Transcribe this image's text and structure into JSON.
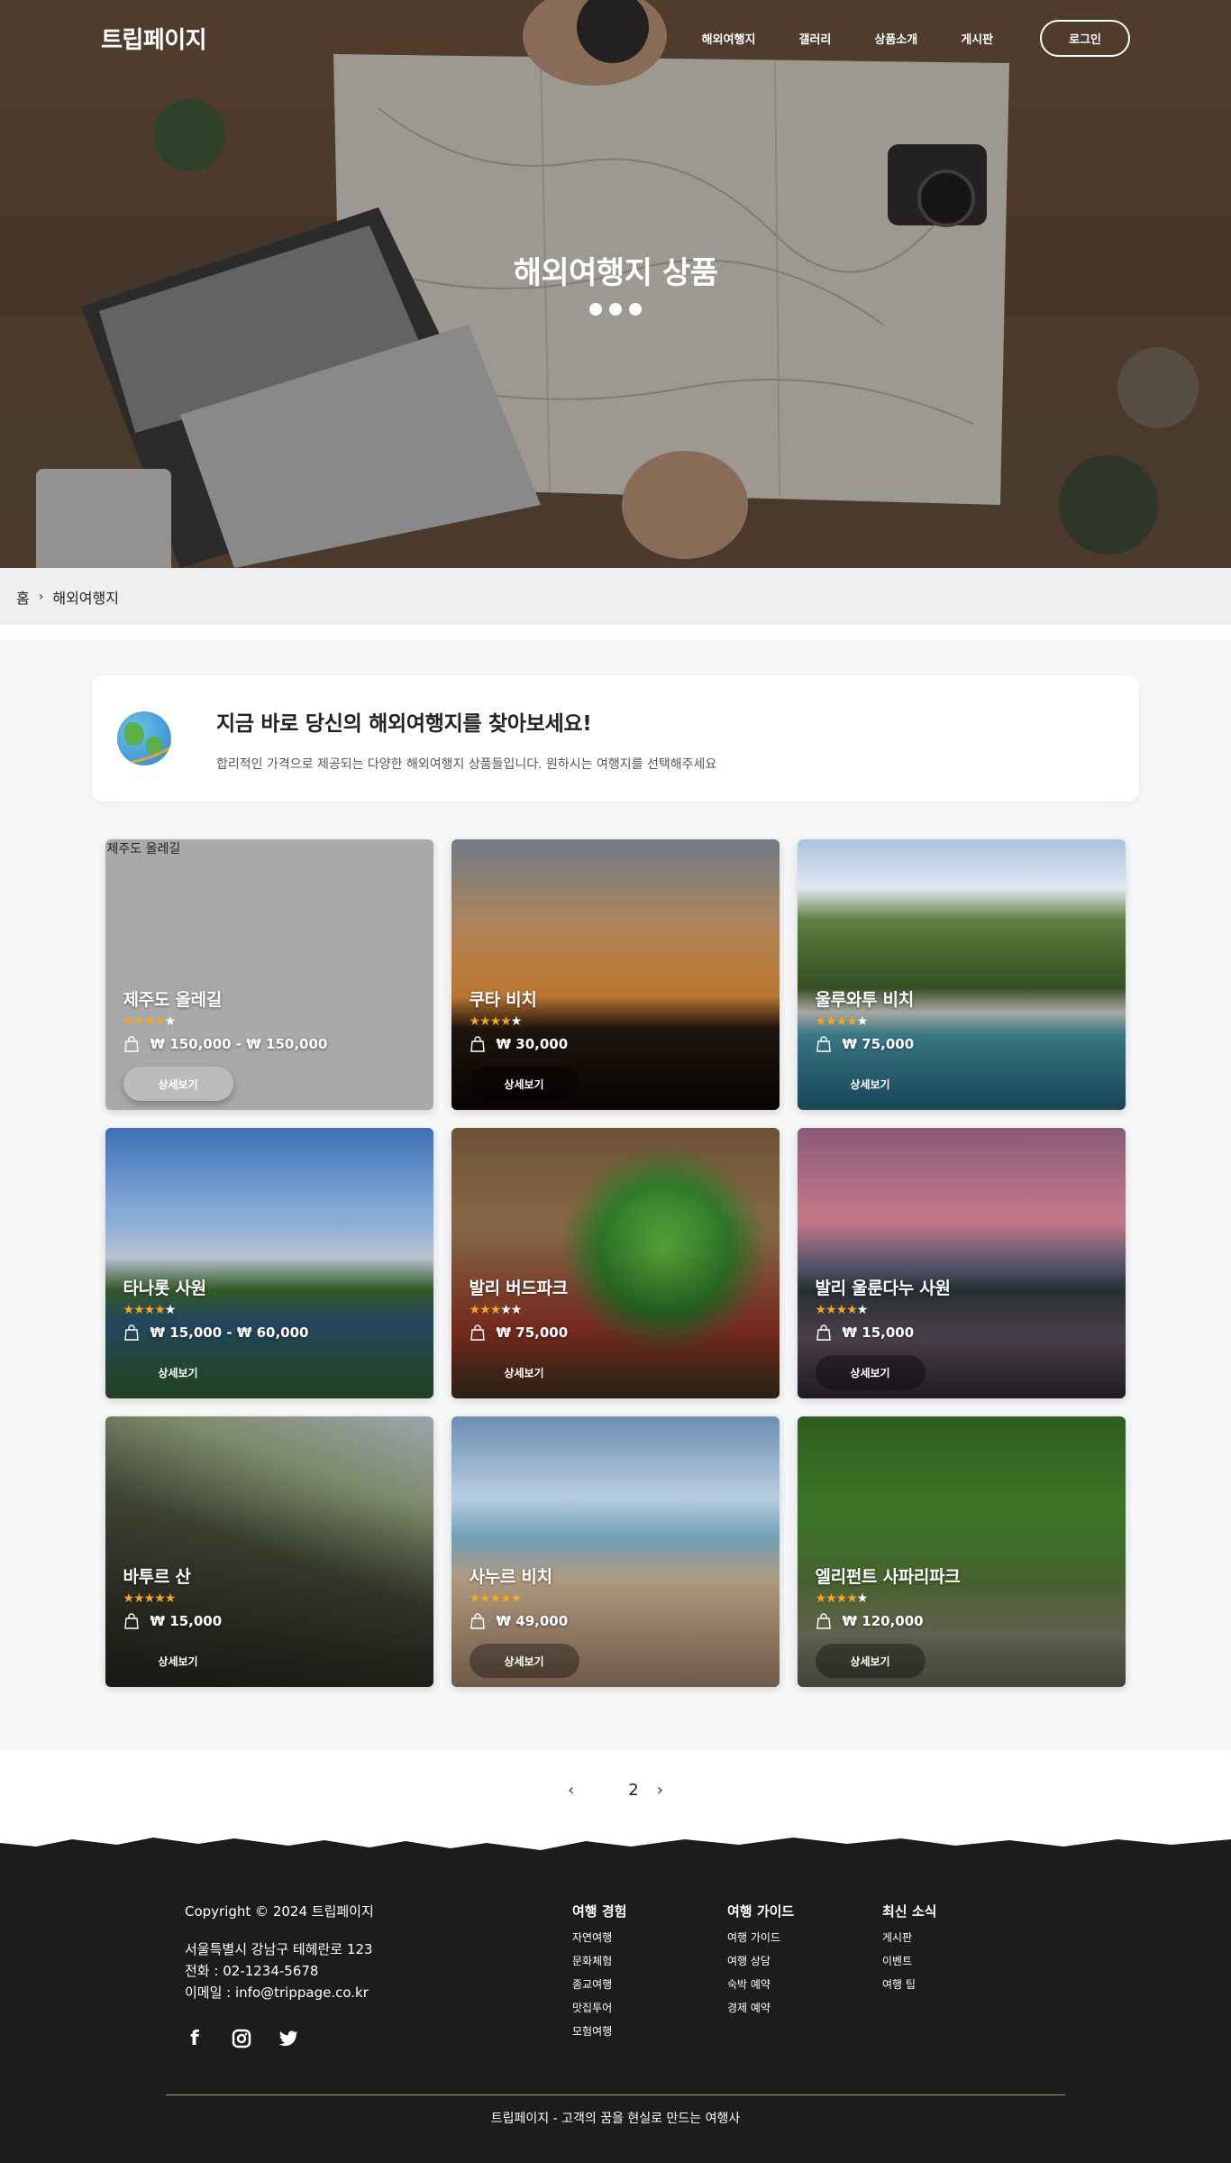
{
  "header": {
    "logo": "트립페이지",
    "nav": [
      "해외여행지",
      "갤러리",
      "상품소개",
      "게시판"
    ],
    "login": "로그인",
    "hero_title": "해외여행지 상품"
  },
  "breadcrumb": {
    "home": "홈",
    "separator": "›",
    "current": "해외여행지"
  },
  "intro": {
    "title": "지금 바로 당신의 해외여행지를 찾아보세요!",
    "description": "합리적인 가격으로 제공되는 다양한 해외여행지 상품들입니다. 원하시는 여행지를 선택해주세요"
  },
  "products": [
    {
      "name": "제주도 올레길",
      "alt": "제주도 올레길",
      "stars": 4,
      "price": "₩ 150,000 - ₩ 150,000",
      "button": "상세보기",
      "theme": "placeholder"
    },
    {
      "name": "쿠타 비치",
      "stars": 4,
      "price": "₩ 30,000",
      "button": "상세보기",
      "theme": "sunset"
    },
    {
      "name": "울루와투 비치",
      "stars": 4,
      "price": "₩ 75,000",
      "button": "상세보기",
      "theme": "cliff"
    },
    {
      "name": "타나롯 사원",
      "stars": 4,
      "price": "₩ 15,000 - ₩ 60,000",
      "button": "상세보기",
      "theme": "temple"
    },
    {
      "name": "발리 버드파크",
      "stars": 3,
      "price": "₩ 75,000",
      "button": "상세보기",
      "theme": "parrot"
    },
    {
      "name": "발리 울룬다누 사원",
      "stars": 4,
      "price": "₩ 15,000",
      "button": "상세보기",
      "theme": "lake"
    },
    {
      "name": "바투르 산",
      "stars": 5,
      "price": "₩ 15,000",
      "button": "상세보기",
      "theme": "mountain"
    },
    {
      "name": "사누르 비치",
      "stars": 5,
      "price": "₩ 49,000",
      "button": "상세보기",
      "theme": "beach"
    },
    {
      "name": "엘리펀트 사파리파크",
      "stars": 4,
      "price": "₩ 120,000",
      "button": "상세보기",
      "theme": "jungle"
    }
  ],
  "pagination": {
    "prev": "‹",
    "page": "2",
    "next": "›"
  },
  "footer": {
    "copyright": "Copyright © 2024 트립페이지",
    "address": "서울특별시 강남구 테헤란로 123",
    "phone": "전화 : 02-1234-5678",
    "email": "이메일 : info@trippage.co.kr",
    "socials": [
      "facebook-icon",
      "instagram-icon",
      "twitter-icon"
    ],
    "columns": [
      {
        "title": "여행 경험",
        "links": [
          "자연여행",
          "문화체험",
          "종교여행",
          "맛집투어",
          "모험여행"
        ]
      },
      {
        "title": "여행 가이드",
        "links": [
          "여행 가이드",
          "여행 상담",
          "숙박 예약",
          "경제 예약"
        ]
      },
      {
        "title": "최신 소식",
        "links": [
          "게시판",
          "이벤트",
          "여행 팁"
        ]
      }
    ],
    "tagline": "트립페이지 - 고객의 꿈을 현실로 만드는 여행사"
  },
  "colors": {
    "star": "#f5a623",
    "footer_bg": "#1c1c1c",
    "footer_line": "#b49a6a"
  }
}
